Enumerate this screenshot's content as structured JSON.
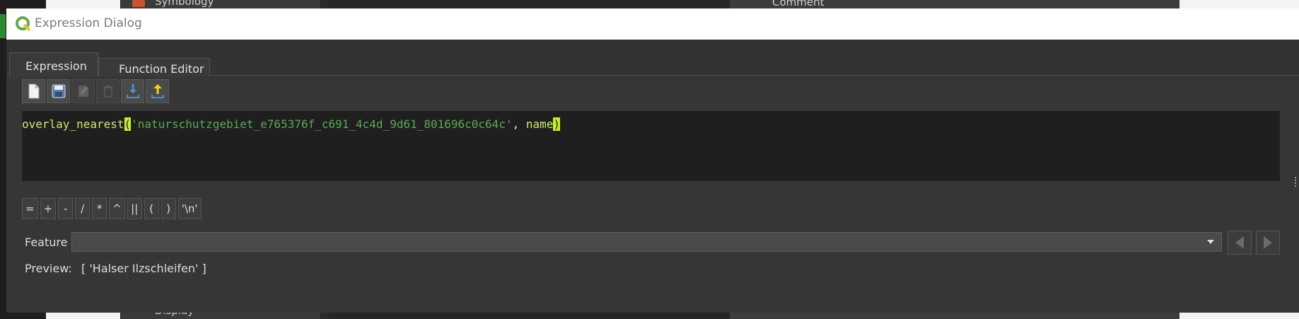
{
  "background": {
    "symbology_label": "Symbology",
    "comment_label": "Comment",
    "display_label": "Display"
  },
  "dialog": {
    "title": "Expression Dialog"
  },
  "tabs": [
    {
      "label": "Expression",
      "active": true
    },
    {
      "label": "Function Editor",
      "active": false
    }
  ],
  "toolbar": {
    "buttons": [
      {
        "icon": "new-file-icon",
        "enabled": true
      },
      {
        "icon": "save-icon",
        "enabled": true
      },
      {
        "icon": "edit-icon",
        "enabled": false
      },
      {
        "icon": "delete-icon",
        "enabled": false
      },
      {
        "icon": "import-icon",
        "enabled": true
      },
      {
        "icon": "export-icon",
        "enabled": true
      }
    ]
  },
  "editor": {
    "function_name": "overlay_nearest",
    "open_paren": "(",
    "string_arg": "'naturschutzgebiet_e765376f_c691_4c4d_9d61_801696c0c64c'",
    "separator": ", ",
    "field_arg": "name",
    "close_paren": ")",
    "colors": {
      "function": "#cfe878",
      "string": "#5aaa54",
      "paren_highlight": "#c6ef2c"
    }
  },
  "operators": [
    "=",
    "+",
    "-",
    "/",
    "*",
    "^",
    "||",
    "(",
    ")",
    "'\\n'"
  ],
  "feature": {
    "label": "Feature",
    "selected": ""
  },
  "preview": {
    "label": "Preview:",
    "value": "[ 'Halser Ilzschleifen' ]"
  }
}
